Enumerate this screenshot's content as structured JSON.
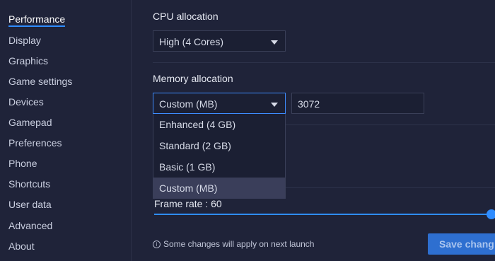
{
  "sidebar": {
    "items": [
      {
        "label": "Performance"
      },
      {
        "label": "Display"
      },
      {
        "label": "Graphics"
      },
      {
        "label": "Game settings"
      },
      {
        "label": "Devices"
      },
      {
        "label": "Gamepad"
      },
      {
        "label": "Preferences"
      },
      {
        "label": "Phone"
      },
      {
        "label": "Shortcuts"
      },
      {
        "label": "User data"
      },
      {
        "label": "Advanced"
      },
      {
        "label": "About"
      }
    ],
    "active_index": 0,
    "accent_color": "#2f8cff"
  },
  "cpu": {
    "label": "CPU allocation",
    "selected": "High (4 Cores)"
  },
  "memory": {
    "label": "Memory allocation",
    "selected": "Custom (MB)",
    "custom_value": "3072",
    "options": [
      {
        "label": "Enhanced (4 GB)"
      },
      {
        "label": "Standard (2 GB)"
      },
      {
        "label": "Basic (1 GB)"
      },
      {
        "label": "Custom (MB)"
      }
    ],
    "highlighted_index": 3
  },
  "frame_rate": {
    "label": "Frame rate : 60",
    "value": 60
  },
  "footer": {
    "info_icon": "i",
    "note": "Some changes will apply on next launch",
    "save_label": "Save chang"
  }
}
